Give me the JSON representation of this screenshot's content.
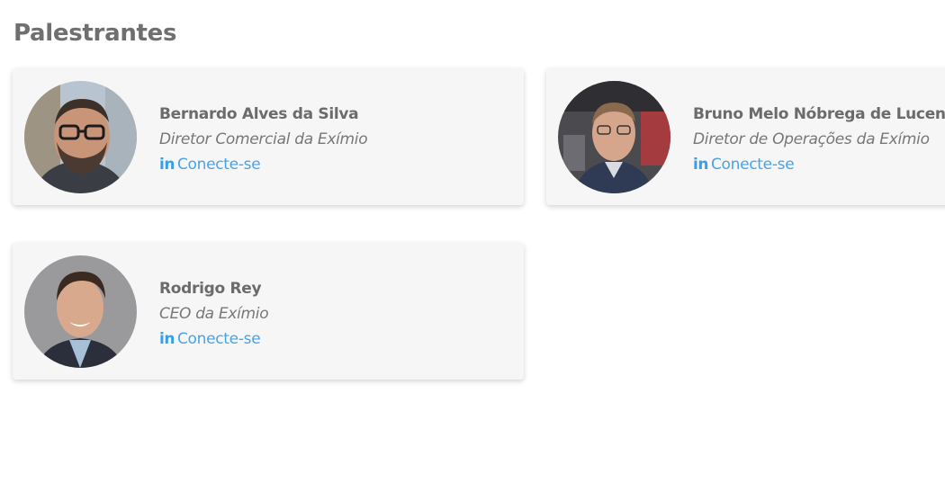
{
  "section": {
    "title": "Palestrantes"
  },
  "accent_color": "#4aa3e4",
  "speakers": [
    {
      "name": "Bernardo Alves da Silva",
      "role": "Diretor Comercial da Exímio",
      "link_icon": "linkedin-icon",
      "link_icon_text": "in",
      "link_label": "Conecte-se"
    },
    {
      "name": "Bruno Melo Nóbrega de Lucena",
      "role": "Diretor de Operações da Exímio",
      "link_icon": "linkedin-icon",
      "link_icon_text": "in",
      "link_label": "Conecte-se"
    },
    {
      "name": "Rodrigo Rey",
      "role": "CEO da Exímio",
      "link_icon": "linkedin-icon",
      "link_icon_text": "in",
      "link_label": "Conecte-se"
    }
  ]
}
